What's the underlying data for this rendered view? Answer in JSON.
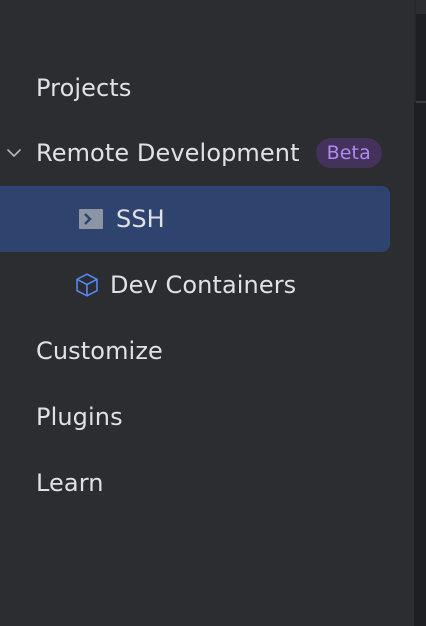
{
  "sidebar": {
    "items": [
      {
        "label": "Projects"
      },
      {
        "label": "Remote Development",
        "badge": "Beta",
        "expanded": true
      },
      {
        "label": "SSH",
        "icon": "terminal-icon",
        "selected": true
      },
      {
        "label": "Dev Containers",
        "icon": "cube-icon"
      },
      {
        "label": "Customize"
      },
      {
        "label": "Plugins"
      },
      {
        "label": "Learn"
      }
    ]
  },
  "colors": {
    "background": "#2b2d30",
    "selected_background": "#2e436e",
    "badge_background": "#43325a",
    "badge_text": "#b189f5",
    "text": "#dfe1e5",
    "cube_icon": "#548af7"
  }
}
